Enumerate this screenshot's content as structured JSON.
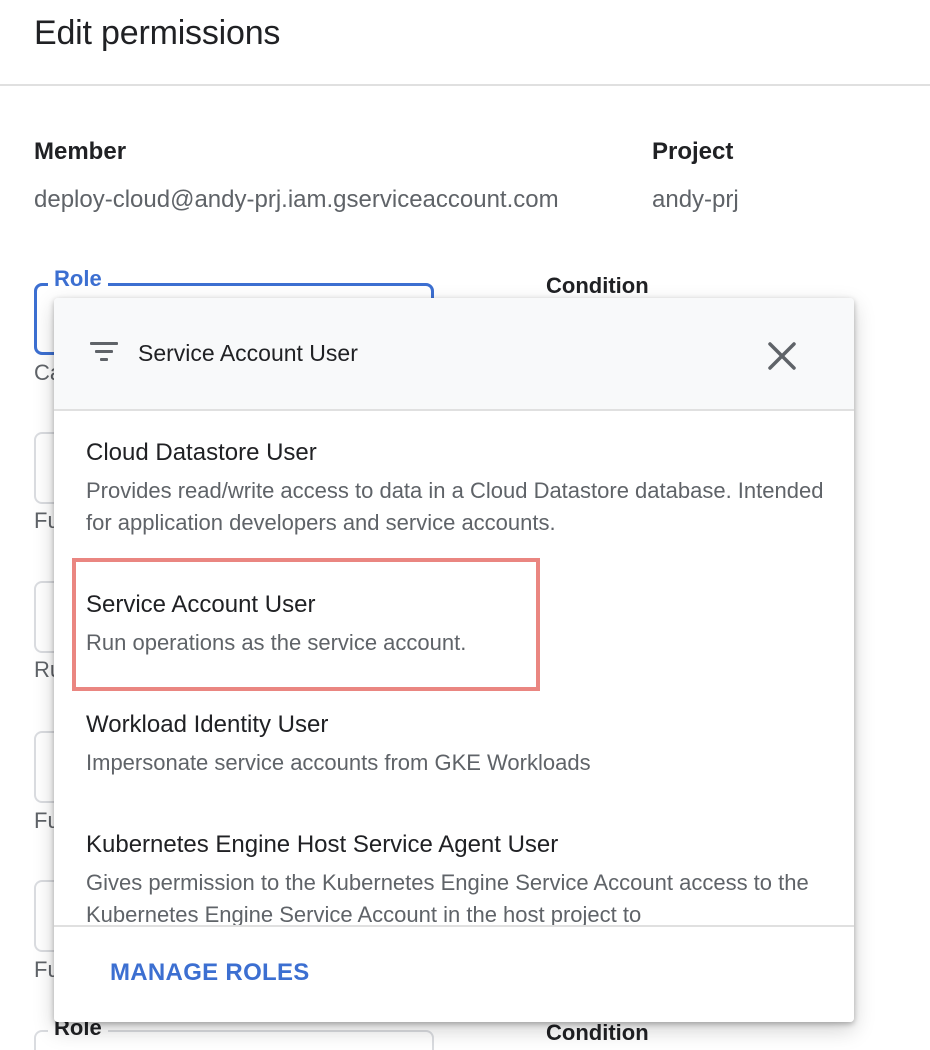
{
  "page": {
    "title": "Edit permissions"
  },
  "member": {
    "label": "Member",
    "value": "deploy-cloud@andy-prj.iam.gserviceaccount.com"
  },
  "project": {
    "label": "Project",
    "value": "andy-prj"
  },
  "role_field": {
    "legend": "Role",
    "helper_fragment": "Ca"
  },
  "condition": {
    "label": "Condition"
  },
  "background_helpers": [
    "Fu",
    "Ru",
    "Fu",
    "Fu"
  ],
  "second_role": {
    "legend": "Role",
    "condition_label": "Condition"
  },
  "dropdown": {
    "filter_text": "Service Account User",
    "roles": [
      {
        "name": "Cloud Datastore User",
        "description": "Provides read/write access to data in a Cloud Datastore database. Intended for application developers and service accounts."
      },
      {
        "name": "Service Account User",
        "description": "Run operations as the service account."
      },
      {
        "name": "Workload Identity User",
        "description": "Impersonate service accounts from GKE Workloads"
      },
      {
        "name": "Kubernetes Engine Host Service Agent User",
        "description": "Gives permission to the Kubernetes Engine Service Account access to the Kubernetes Engine Service Account in the host project to"
      }
    ],
    "footer_action": "MANAGE ROLES"
  },
  "colors": {
    "accent": "#3c6fd1",
    "highlight": "#ea8681",
    "text_secondary": "#5f6368"
  },
  "icons": {
    "filter": "filter-icon",
    "close": "close-icon"
  }
}
